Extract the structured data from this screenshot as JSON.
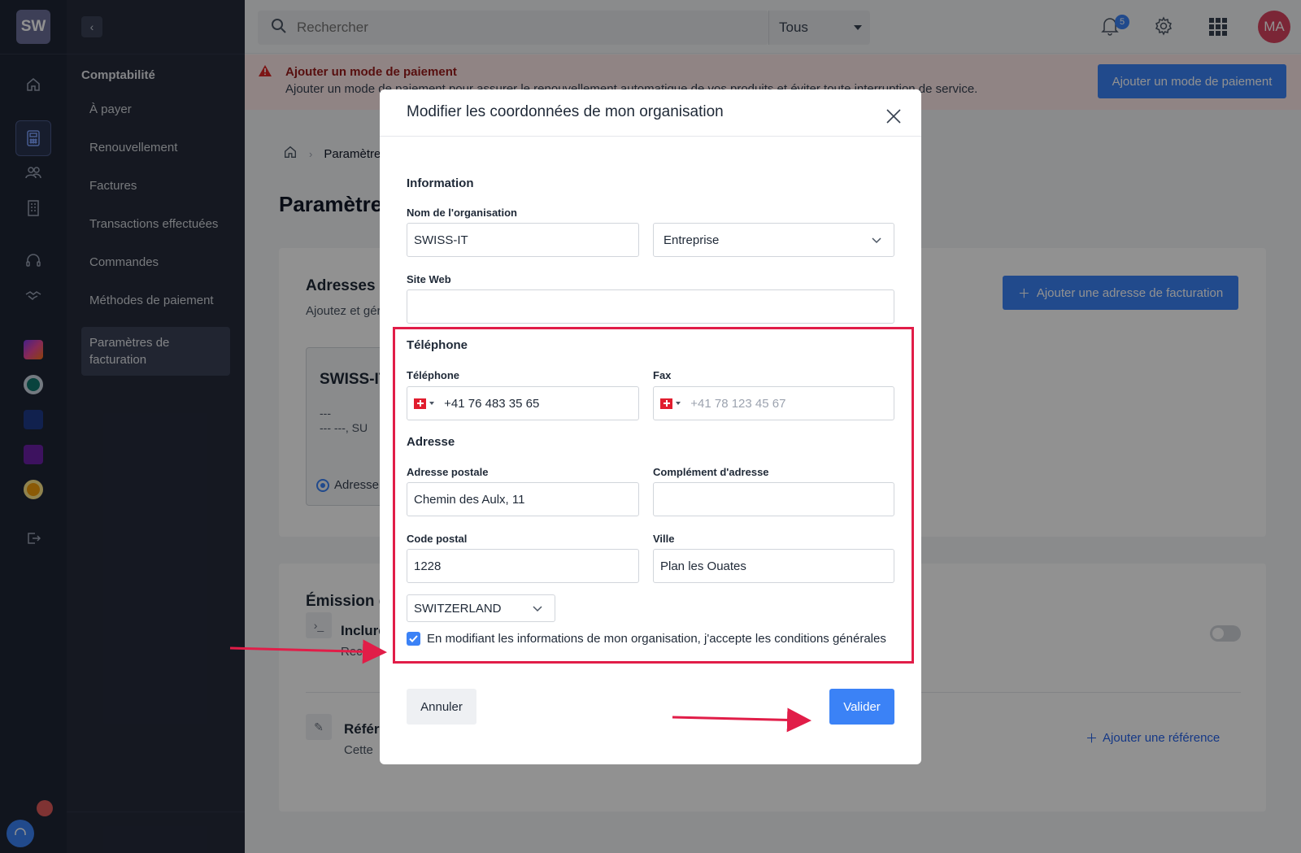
{
  "rail": {
    "logo": "SW"
  },
  "sidebar": {
    "group": "Comptabilité",
    "items": [
      {
        "label": "À payer"
      },
      {
        "label": "Renouvellement"
      },
      {
        "label": "Factures"
      },
      {
        "label": "Transactions effectuées"
      },
      {
        "label": "Commandes"
      },
      {
        "label": "Méthodes de paiement"
      },
      {
        "label": "Paramètres de facturation"
      }
    ]
  },
  "topbar": {
    "search_placeholder": "Rechercher",
    "scope": "Tous",
    "notifications": "5",
    "avatar": "MA"
  },
  "alert": {
    "title": "Ajouter un mode de paiement",
    "message": "Ajouter un mode de paiement pour assurer le renouvellement automatique de vos produits et éviter toute interruption de service.",
    "button": "Ajouter un mode de paiement"
  },
  "page": {
    "breadcrumb": "Paramètres de facturation",
    "title": "Paramètres de facturation",
    "addresses": {
      "title": "Adresses de facturation",
      "subtitle": "Ajoutez et gérez vos adresses de facturation",
      "add_button": "Ajouter une adresse de facturation",
      "card_name": "SWISS-IT",
      "card_line1": "---",
      "card_line2": "--- ---, SU",
      "card_radio": "Adresse"
    },
    "emission": {
      "title": "Émission de factures",
      "row1_title": "Inclure",
      "row1_sub": "Recevez",
      "row2_title": "Référence",
      "row2_sub": "Cette",
      "ref_link": "Ajouter une référence"
    }
  },
  "modal": {
    "title": "Modifier les coordonnées de mon organisation",
    "info_section": "Information",
    "org_name_label": "Nom de l'organisation",
    "org_name_value": "SWISS-IT",
    "org_type_value": "Entreprise",
    "website_label": "Site Web",
    "website_value": "",
    "phone_section": "Téléphone",
    "phone_label": "Téléphone",
    "phone_value": "+41 76 483 35 65",
    "fax_label": "Fax",
    "fax_placeholder": "+41 78 123 45 67",
    "address_section": "Adresse",
    "street_label": "Adresse postale",
    "street_value": "Chemin des Aulx, 11",
    "complement_label": "Complément d'adresse",
    "complement_value": "",
    "zip_label": "Code postal",
    "zip_value": "1228",
    "city_label": "Ville",
    "city_value": "Plan les Ouates",
    "country_value": "SWITZERLAND",
    "terms": "En modifiant les informations de mon organisation, j'accepte les conditions générales",
    "terms_checked": true,
    "cancel": "Annuler",
    "submit": "Valider"
  },
  "colors": {
    "primary": "#3b82f6",
    "highlight": "#e11d48",
    "sidebar": "#252b3b",
    "rail": "#1f2535"
  }
}
